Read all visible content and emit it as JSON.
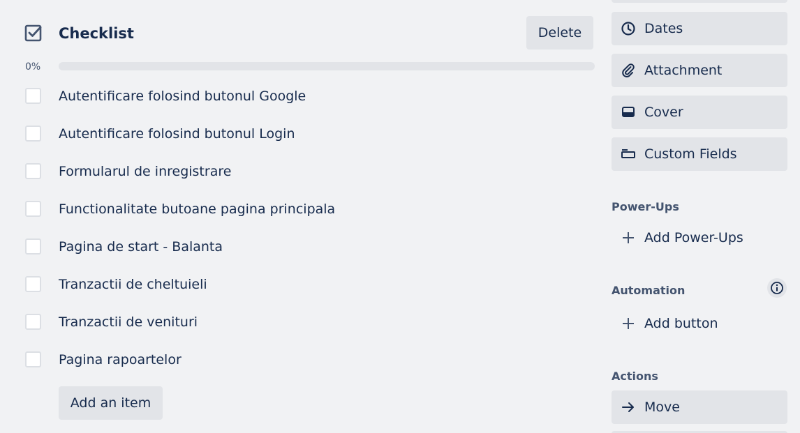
{
  "checklist": {
    "title": "Checklist",
    "delete_label": "Delete",
    "progress_label": "0%",
    "progress_fraction": 0,
    "items": [
      {
        "label": "Autentificare folosind butonul Google",
        "checked": false
      },
      {
        "label": "Autentificare folosind butonul Login",
        "checked": false
      },
      {
        "label": "Formularul de inregistrare",
        "checked": false
      },
      {
        "label": "Functionalitate butoane pagina principala",
        "checked": false
      },
      {
        "label": "Pagina de start - Balanta",
        "checked": false
      },
      {
        "label": "Tranzactii de cheltuieli",
        "checked": false
      },
      {
        "label": "Tranzactii de venituri",
        "checked": false
      },
      {
        "label": "Pagina rapoartelor",
        "checked": false
      }
    ],
    "add_item_label": "Add an item"
  },
  "sidebar": {
    "add_to_card": [
      {
        "label": "Dates",
        "icon": "clock-icon"
      },
      {
        "label": "Attachment",
        "icon": "paperclip-icon"
      },
      {
        "label": "Cover",
        "icon": "cover-icon"
      },
      {
        "label": "Custom Fields",
        "icon": "custom-fields-icon"
      }
    ],
    "powerups": {
      "heading": "Power-Ups",
      "add_label": "Add Power-Ups"
    },
    "automation": {
      "heading": "Automation",
      "add_label": "Add button",
      "info_icon": "info-icon"
    },
    "actions": {
      "heading": "Actions",
      "move_label": "Move"
    }
  },
  "colors": {
    "background": "#f1f2f4",
    "button_bg": "#e2e4e8",
    "text": "#172b4d",
    "subtle_text": "#44546f"
  }
}
